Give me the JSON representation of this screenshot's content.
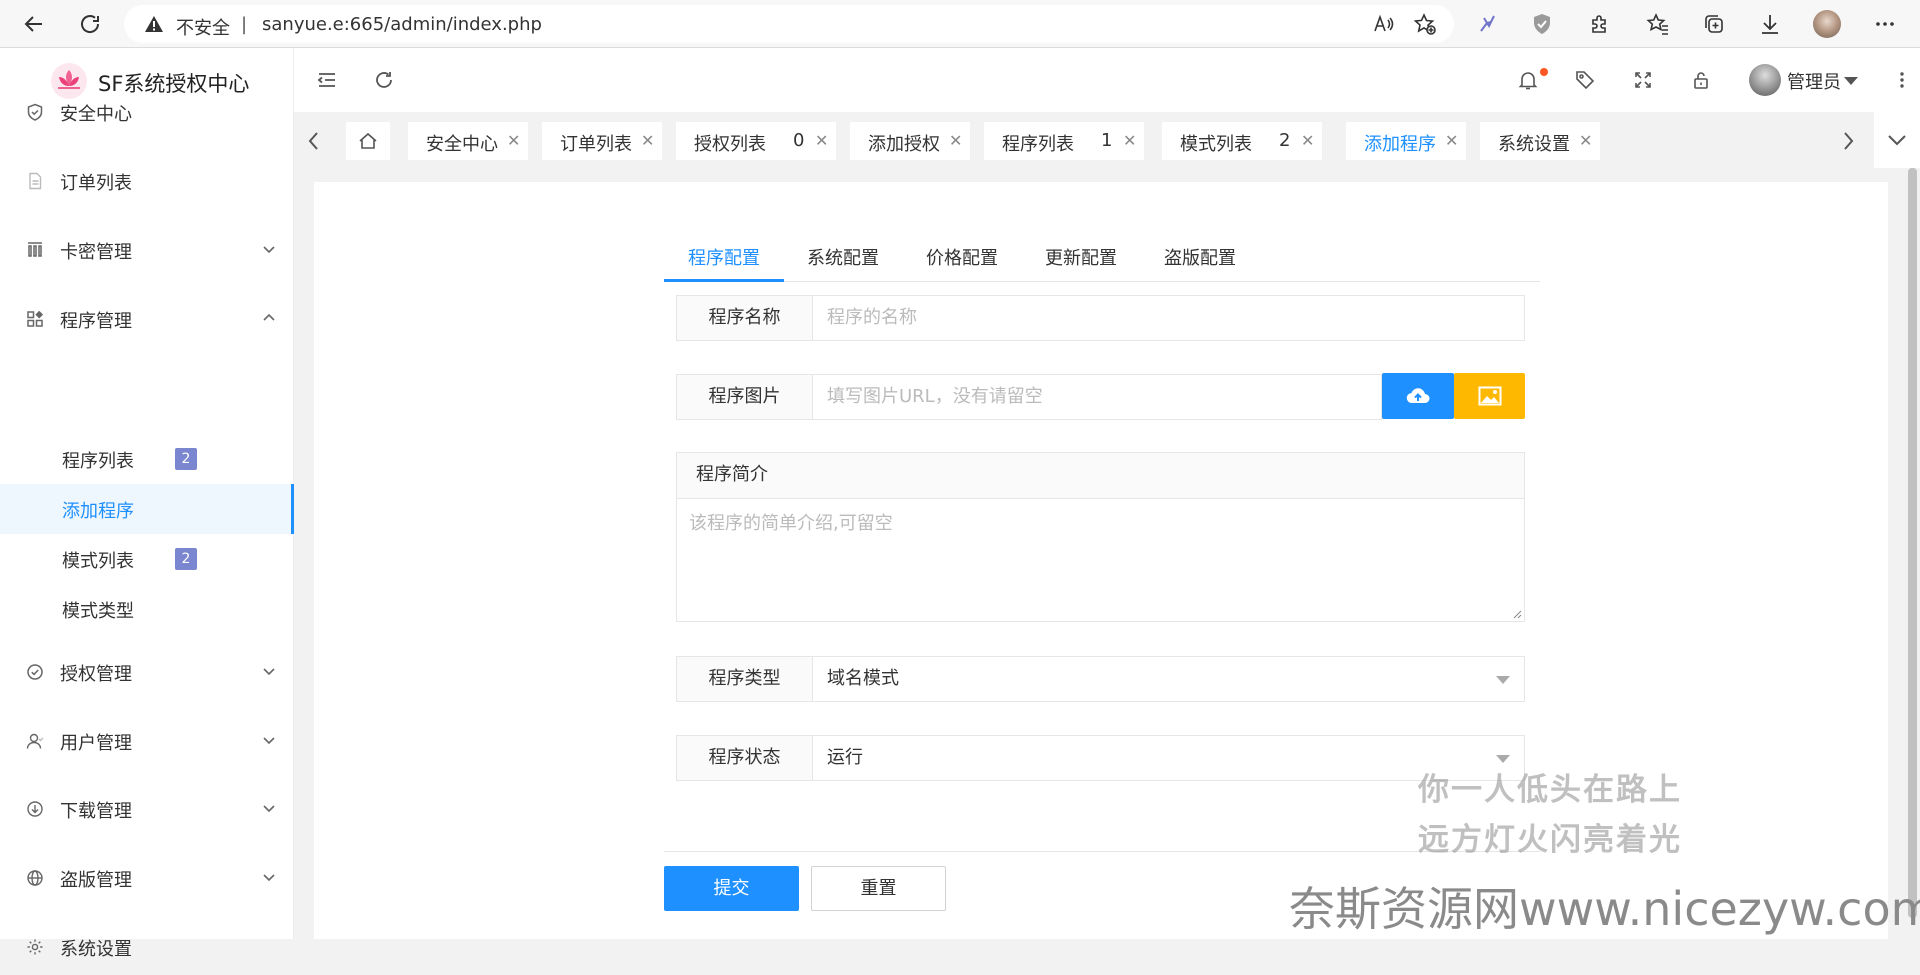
{
  "browser": {
    "insecure_label": "不安全",
    "separator": "|",
    "url": "sanyue.e:665/admin/index.php"
  },
  "sidebar": {
    "brand": "SF系统授权中心",
    "items": [
      {
        "label": "安全中心",
        "icon": "shield-icon"
      },
      {
        "label": "订单列表",
        "icon": "document-icon"
      },
      {
        "label": "卡密管理",
        "icon": "grid-icon",
        "expanded": false
      },
      {
        "label": "程序管理",
        "icon": "apps-icon",
        "expanded": true
      },
      {
        "label": "授权管理",
        "icon": "check-circle-icon",
        "expanded": false
      },
      {
        "label": "用户管理",
        "icon": "user-icon",
        "expanded": false
      },
      {
        "label": "下载管理",
        "icon": "download-icon",
        "expanded": false
      },
      {
        "label": "盗版管理",
        "icon": "globe-icon",
        "expanded": false
      },
      {
        "label": "系统设置",
        "icon": "gear-icon"
      }
    ],
    "sub_items": [
      {
        "label": "程序列表",
        "badge": "2"
      },
      {
        "label": "添加程序",
        "active": true
      },
      {
        "label": "模式列表",
        "badge": "2"
      },
      {
        "label": "模式类型"
      }
    ]
  },
  "header": {
    "user_name": "管理员"
  },
  "tabs": [
    {
      "label": "安全中心"
    },
    {
      "label": "订单列表"
    },
    {
      "label": "授权列表",
      "num": "0"
    },
    {
      "label": "添加授权"
    },
    {
      "label": "程序列表",
      "num": "1"
    },
    {
      "label": "模式列表",
      "num": "2"
    },
    {
      "label": "添加程序",
      "active": true
    },
    {
      "label": "系统设置"
    }
  ],
  "form": {
    "tabs": [
      "程序配置",
      "系统配置",
      "价格配置",
      "更新配置",
      "盗版配置"
    ],
    "active_tab": "程序配置",
    "name_label": "程序名称",
    "name_placeholder": "程序的名称",
    "image_label": "程序图片",
    "image_placeholder": "填写图片URL，没有请留空",
    "intro_label": "程序简介",
    "intro_placeholder": "该程序的简单介绍,可留空",
    "type_label": "程序类型",
    "type_value": "域名模式",
    "status_label": "程序状态",
    "status_value": "运行",
    "submit": "提交",
    "reset": "重置"
  },
  "overlay": {
    "lyric_line1": "你一人低头在路上",
    "lyric_line2": "远方灯火闪亮着光",
    "watermark": "奈斯资源网www.nicezyw.com"
  },
  "colors": {
    "accent": "#1e90ff",
    "upload_button": "#1e90ff",
    "image_button": "#ffb800",
    "badge": "#7b86d1",
    "notification_dot": "#ff5722"
  }
}
